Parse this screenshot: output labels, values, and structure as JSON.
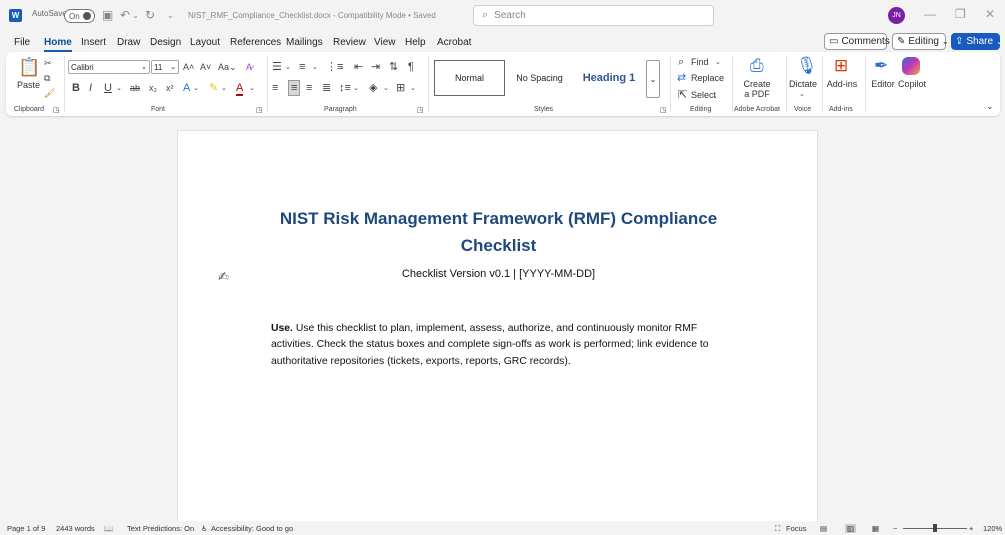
{
  "titlebar": {
    "app_icon": "word-icon",
    "autosave_label": "AutoSave",
    "autosave_state": "On",
    "doc_title": "NIST_RMF_Compliance_Checklist.docx - Compatibility Mode • Saved",
    "search_placeholder": "Search",
    "avatar_initials": "JN"
  },
  "menu": {
    "items": [
      "File",
      "Home",
      "Insert",
      "Draw",
      "Design",
      "Layout",
      "References",
      "Mailings",
      "Review",
      "View",
      "Help",
      "Acrobat"
    ],
    "active": "Home",
    "comments_label": "Comments",
    "editing_label": "Editing",
    "share_label": "Share"
  },
  "ribbon": {
    "clipboard": {
      "paste": "Paste",
      "label": "Clipboard"
    },
    "font": {
      "name": "Calibri",
      "size": "11",
      "label": "Font"
    },
    "paragraph": {
      "label": "Paragraph"
    },
    "styles": {
      "normal": "Normal",
      "no_spacing": "No Spacing",
      "heading1": "Heading 1",
      "label": "Styles"
    },
    "editing": {
      "find": "Find",
      "replace": "Replace",
      "select": "Select",
      "label": "Editing"
    },
    "acrobat": {
      "create_line1": "Create",
      "create_line2": "a PDF",
      "label": "Adobe Acrobat"
    },
    "voice": {
      "dictate": "Dictate",
      "label": "Voice"
    },
    "addins": {
      "addins": "Add-ins",
      "label": "Add-ins"
    },
    "editor": "Editor",
    "copilot": "Copilot"
  },
  "document": {
    "title_line1": "NIST Risk Management Framework (RMF) Compliance",
    "title_line2": "Checklist",
    "subtitle": "Checklist Version v0.1 | [YYYY-MM-DD]",
    "use_label": "Use.",
    "use_text": " Use this checklist to plan, implement, assess, authorize, and continuously monitor RMF activities. Check the status boxes and complete sign-offs as work is performed; link evidence to authoritative repositories (tickets, exports, reports, GRC records)."
  },
  "status": {
    "page": "Page 1 of 9",
    "words": "2443 words",
    "predictions": "Text Predictions: On",
    "accessibility": "Accessibility: Good to go",
    "focus": "Focus",
    "zoom": "120%"
  },
  "colors": {
    "brand": "#185abd",
    "heading": "#1f497d",
    "avatar": "#7a1fa2"
  }
}
